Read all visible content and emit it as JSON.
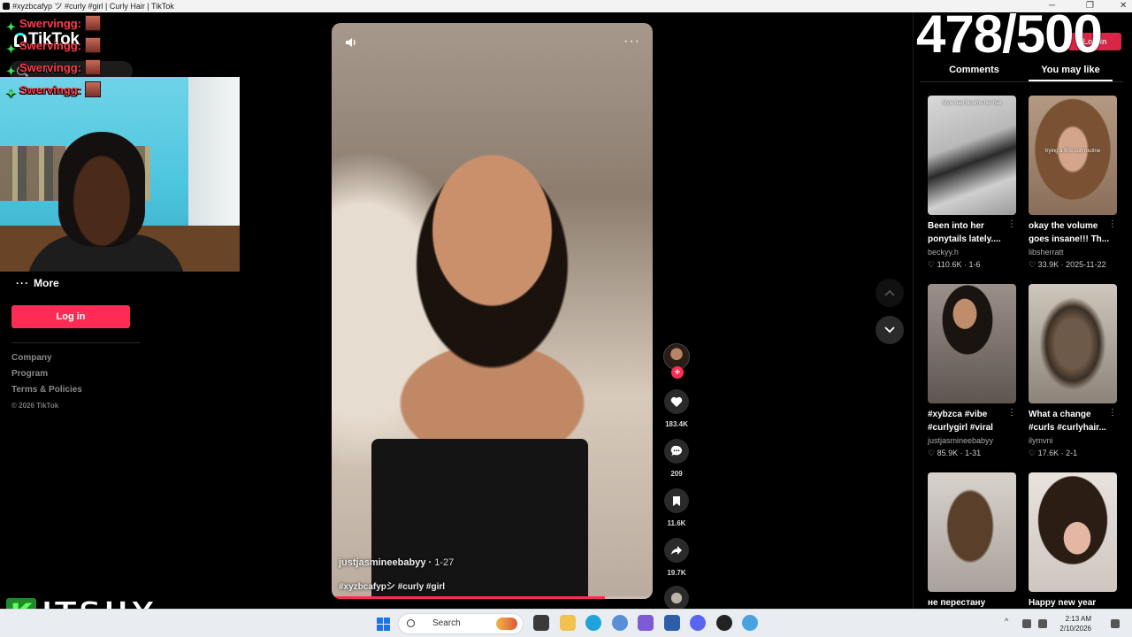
{
  "browser": {
    "tab_title": "#xyzbcafyp ツ #curly #girl | Curly Hair | TikTok"
  },
  "sidebar": {
    "logo_text": "TikTok",
    "search_placeholder": "Search",
    "more_label": "More",
    "login_label": "Log in",
    "footer_links": [
      "Company",
      "Program",
      "Terms & Policies"
    ],
    "copyright": "© 2026 TikTok"
  },
  "stream_overlay": {
    "chat_lines": [
      {
        "user": "Swervingg:"
      },
      {
        "user": "Swervingg:"
      },
      {
        "user": "Swervingg:"
      },
      {
        "user": "Swervingg:"
      }
    ],
    "streamer_badge_letter": "K",
    "streamer_name": "ITSJJX",
    "counter": "478/500"
  },
  "video": {
    "author": "justjasmineebabyy",
    "date": "1-27",
    "tags": "#xyzbcafypシ #curly #girl",
    "progress": 0.85
  },
  "actions": {
    "likes": "183.4K",
    "comments": "209",
    "saves": "11.6K",
    "shares": "19.7K"
  },
  "right_panel": {
    "login_label": "Log in",
    "tabs": [
      "Comments",
      "You may like"
    ],
    "active_tab": "You may like",
    "cards": [
      {
        "title": "Been into her ponytails lately....",
        "author": "beckyy.h",
        "likes": "110.6K",
        "date": "1-6",
        "caption": "Style dad blooms her hair"
      },
      {
        "title": "okay the volume goes insane!!! Th...",
        "author": "libsherratt",
        "likes": "33.9K",
        "date": "2025-11-22",
        "caption": "trying a 90s curl routine"
      },
      {
        "title": "#xybzca #vibe #curlygirl #viral",
        "author": "justjasmineebabyy",
        "likes": "85.9K",
        "date": "1-31",
        "caption": ""
      },
      {
        "title": "What a change #curls #curlyhair...",
        "author": "ilymvni",
        "likes": "17.6K",
        "date": "2-1",
        "caption": ""
      },
      {
        "title": "не перестану",
        "author": "",
        "likes": "",
        "date": "",
        "caption": ""
      },
      {
        "title": "Happy new year",
        "author": "",
        "likes": "",
        "date": "",
        "caption": ""
      }
    ]
  },
  "taskbar": {
    "search_label": "Search",
    "time": "2:13 AM",
    "date": "2/10/2026"
  },
  "colors": {
    "accent": "#fe2c55",
    "background": "#000000",
    "chat_name": "#ff3a4a",
    "chat_star": "#39e05a"
  }
}
